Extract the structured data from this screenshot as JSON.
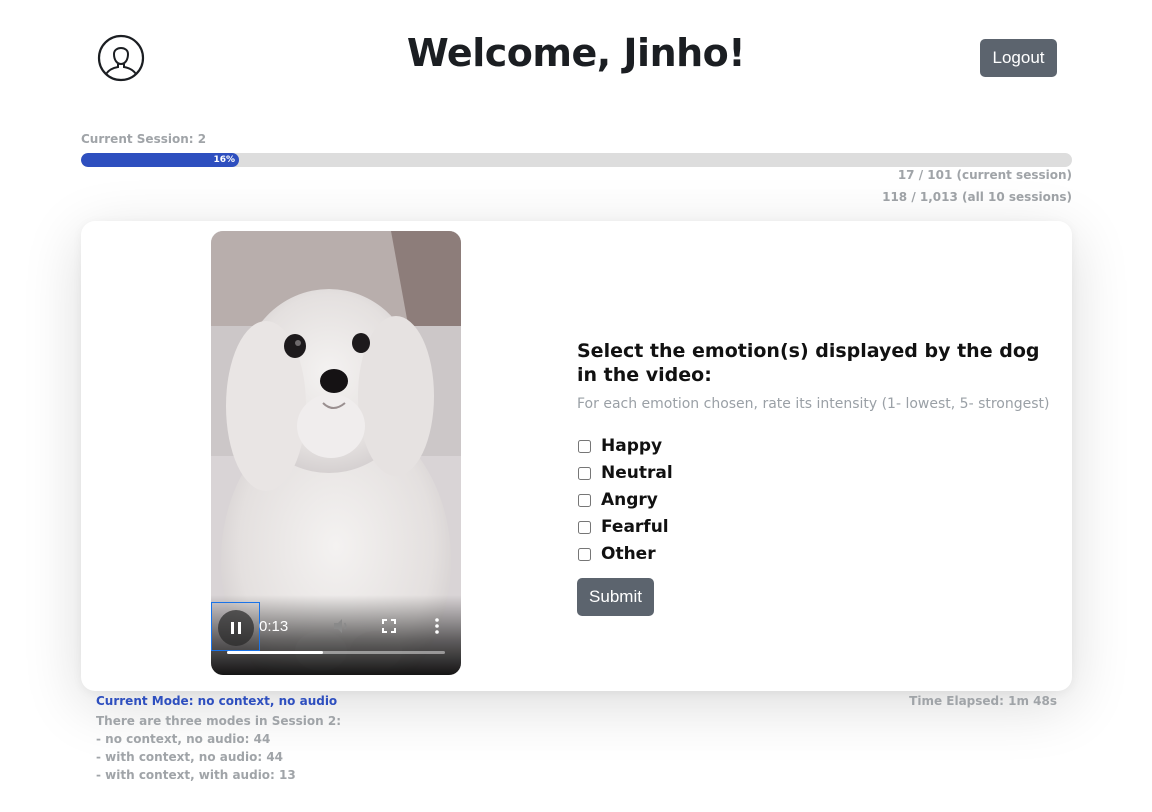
{
  "header": {
    "title": "Welcome, Jinho!",
    "logout_label": "Logout",
    "avatar_icon": "user-avatar-icon"
  },
  "progress": {
    "session_label": "Current Session: 2",
    "percent_label": "16%",
    "percent_value": 16,
    "current_session_count": "17 / 101 (current session)",
    "all_sessions_count": "118 / 1,013 (all 10 sessions)",
    "accent_color": "#2e4fbf"
  },
  "video": {
    "time": "0:13",
    "played_fraction": 0.44,
    "icons": [
      "pause-icon",
      "volume-icon",
      "fullscreen-icon",
      "more-options-icon"
    ]
  },
  "question": {
    "title": "Select the emotion(s) displayed by the dog in the video:",
    "hint": "For each emotion chosen, rate its intensity (1- lowest, 5- strongest)",
    "options": [
      {
        "label": "Happy",
        "checked": false
      },
      {
        "label": "Neutral",
        "checked": false
      },
      {
        "label": "Angry",
        "checked": false
      },
      {
        "label": "Fearful",
        "checked": false
      },
      {
        "label": "Other",
        "checked": false
      }
    ],
    "submit_label": "Submit"
  },
  "footer": {
    "current_mode": "Current Mode: no context, no audio",
    "time_elapsed": "Time Elapsed: 1m 48s",
    "modes_intro": "There are three modes in Session 2:",
    "modes": [
      "- no context, no audio: 44",
      "- with context, no audio: 44",
      "- with context, with audio: 13"
    ]
  }
}
